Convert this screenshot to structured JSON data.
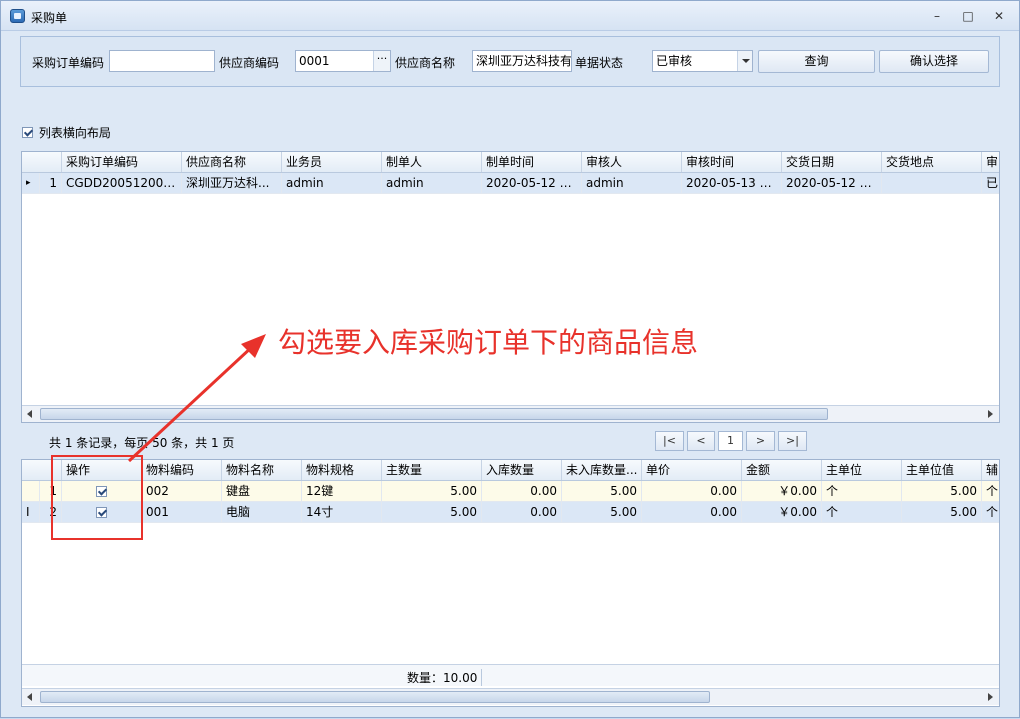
{
  "window": {
    "title": "采购单",
    "minimize_glyph": "–",
    "maximize_glyph": "□",
    "close_glyph": "✕"
  },
  "search": {
    "order_code_label": "采购订单编码",
    "order_code_value": "",
    "supplier_code_label": "供应商编码",
    "supplier_code_value": "0001",
    "ellipsis": "···",
    "supplier_name_label": "供应商名称",
    "supplier_name_value": "深圳亚万达科技有",
    "status_label": "单据状态",
    "status_value": "已审核",
    "query_button": "查询",
    "confirm_button": "确认选择"
  },
  "layout_toggle": {
    "label": "列表横向布局",
    "checked": true
  },
  "orders_grid": {
    "columns": [
      "采购订单编码",
      "供应商名称",
      "业务员",
      "制单人",
      "制单时间",
      "审核人",
      "审核时间",
      "交货日期",
      "交货地点",
      "审"
    ],
    "rows": [
      {
        "indicator": "▸",
        "num": "1",
        "cells": [
          "CGDD20051200001",
          "深圳亚万达科...",
          "admin",
          "admin",
          "2020-05-12 1...",
          "admin",
          "2020-05-13 1...",
          "2020-05-12 0...",
          "",
          "已("
        ]
      }
    ]
  },
  "pager": {
    "summary": "共 1 条记录，每页 50 条，共 1 页",
    "first": "|<",
    "prev": "<",
    "page": "1",
    "next": ">",
    "last": ">|"
  },
  "detail_grid": {
    "columns": [
      "操作",
      "物料编码",
      "物料名称",
      "物料规格",
      "主数量",
      "入库数量",
      "未入库数量...",
      "单价",
      "金额",
      "主单位",
      "主单位值",
      "辅"
    ],
    "rows": [
      {
        "num": "1",
        "indicator": "",
        "checked": true,
        "cells": [
          "002",
          "键盘",
          "12键",
          "5.00",
          "0.00",
          "5.00",
          "0.00",
          "￥0.00",
          "个",
          "5.00",
          "个"
        ]
      },
      {
        "num": "2",
        "indicator": "I",
        "checked": true,
        "cells": [
          "001",
          "电脑",
          "14寸",
          "5.00",
          "0.00",
          "5.00",
          "0.00",
          "￥0.00",
          "个",
          "5.00",
          "个"
        ]
      }
    ],
    "footer": "数量：10.00"
  },
  "annotation": {
    "text": "勾选要入库采购订单下的商品信息",
    "color": "#e8322b"
  }
}
